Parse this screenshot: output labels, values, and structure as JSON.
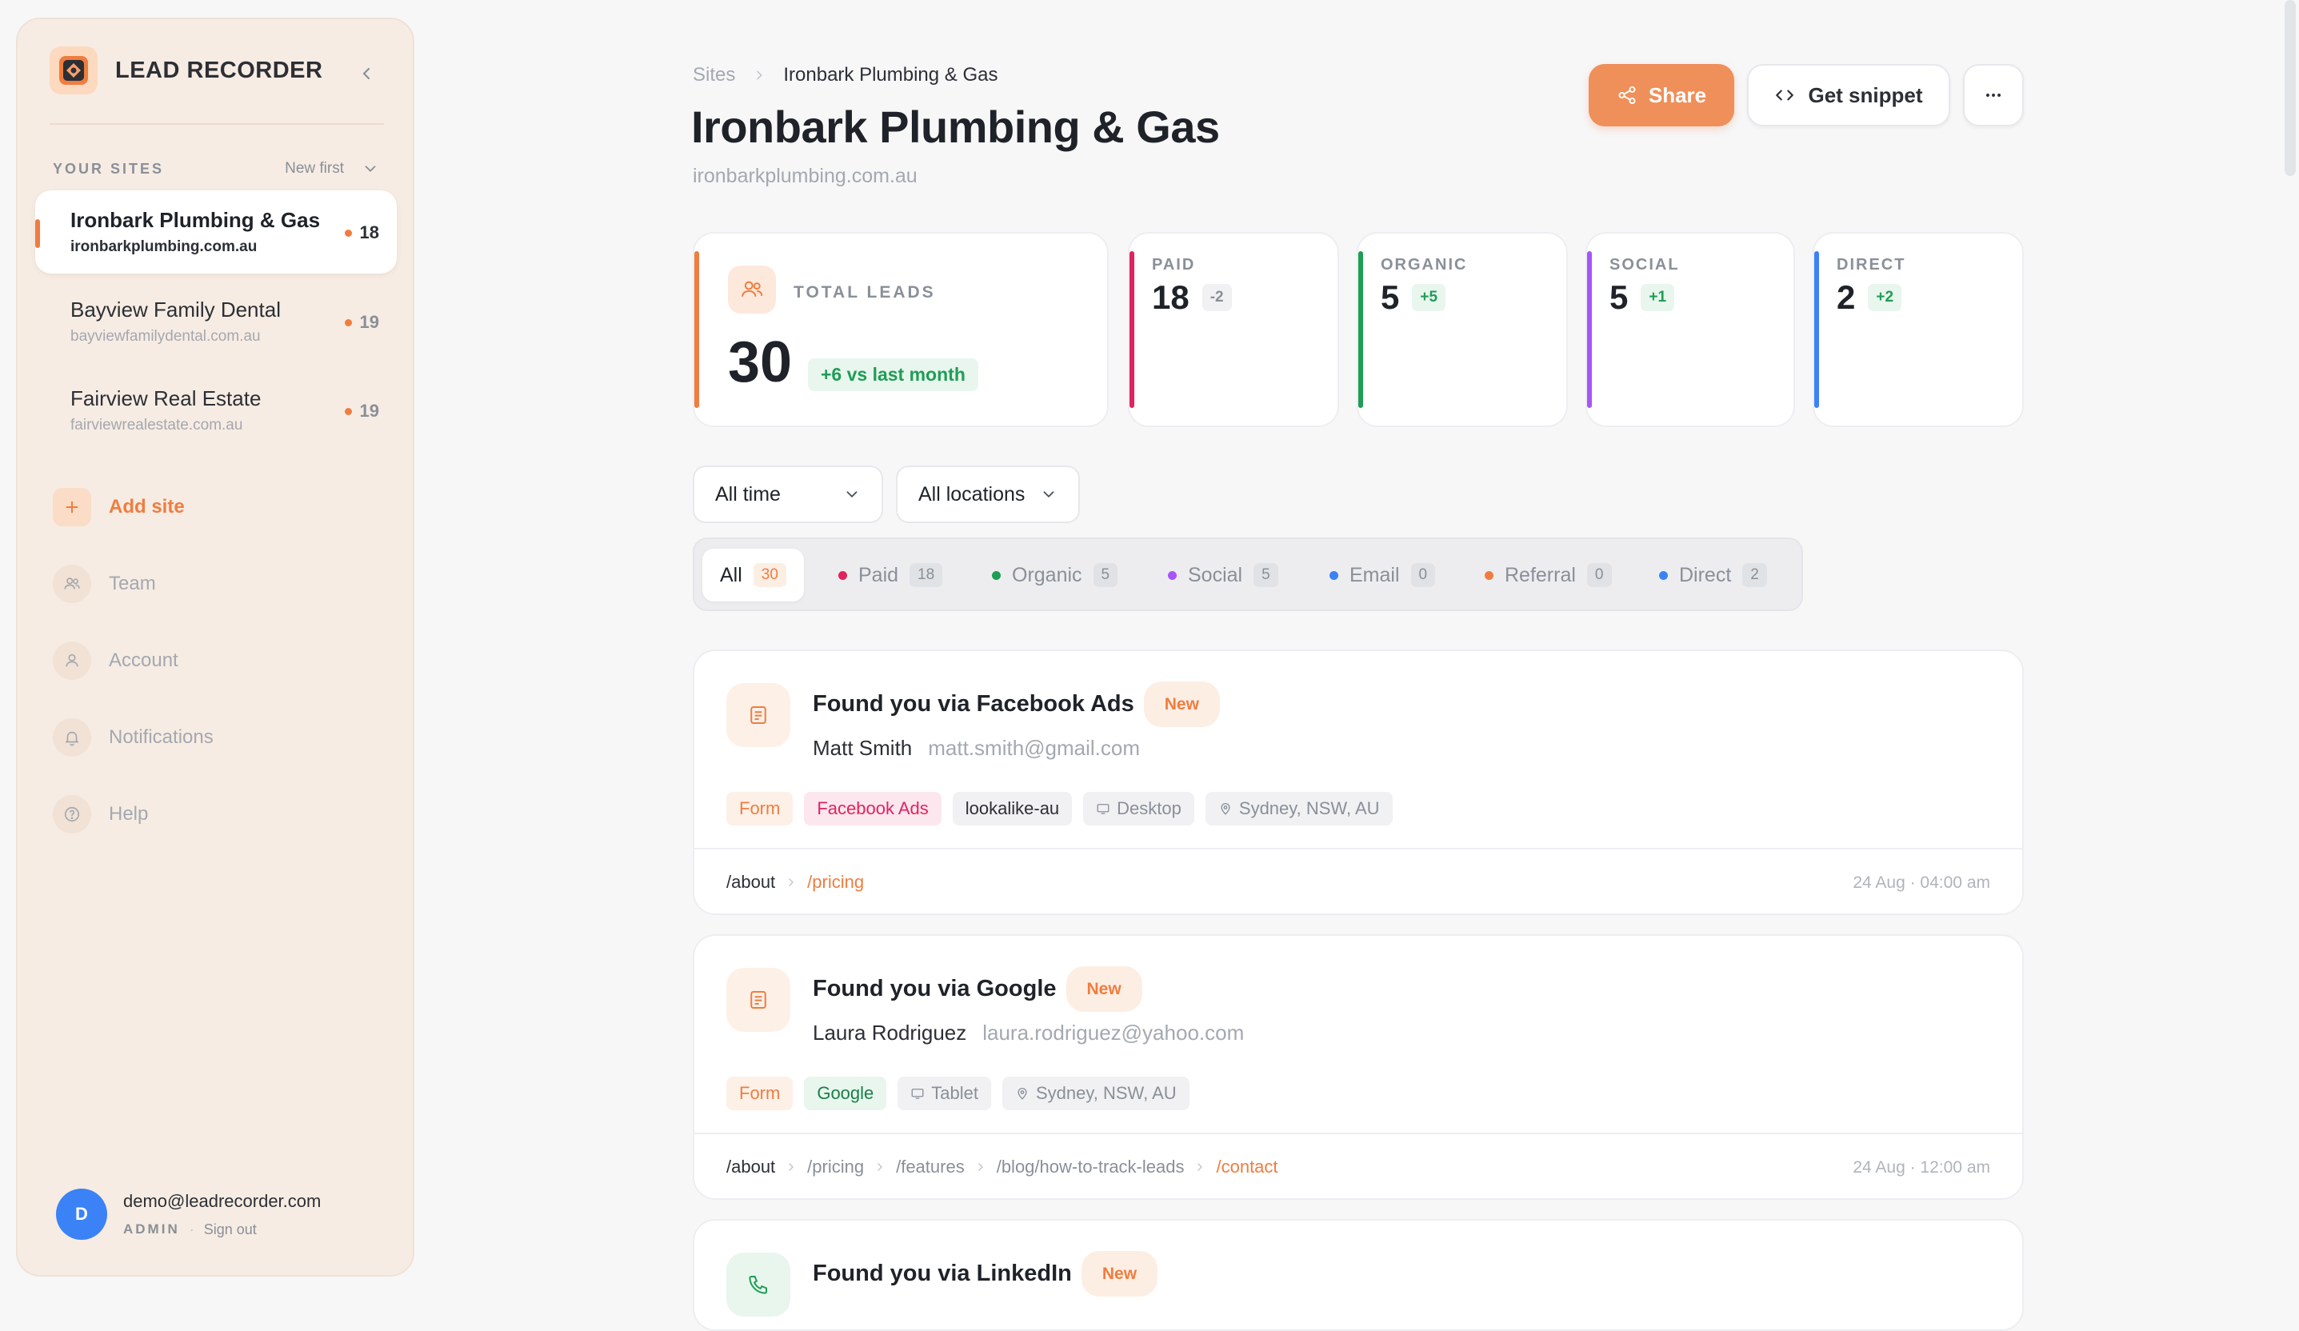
{
  "sidebar": {
    "brand": "LEAD RECORDER",
    "your_sites_label": "YOUR SITES",
    "sort_label": "New first",
    "sites": [
      {
        "name": "Ironbark Plumbing & Gas",
        "domain": "ironbarkplumbing.com.au",
        "count": "18",
        "active": true
      },
      {
        "name": "Bayview Family Dental",
        "domain": "bayviewfamilydental.com.au",
        "count": "19",
        "active": false
      },
      {
        "name": "Fairview Real Estate",
        "domain": "fairviewrealestate.com.au",
        "count": "19",
        "active": false
      }
    ],
    "add_site": "Add site",
    "nav": [
      {
        "label": "Team",
        "icon": "users-icon"
      },
      {
        "label": "Account",
        "icon": "user-icon"
      },
      {
        "label": "Notifications",
        "icon": "bell-icon"
      },
      {
        "label": "Help",
        "icon": "help-icon"
      }
    ],
    "user": {
      "initial": "D",
      "email": "demo@leadrecorder.com",
      "role": "ADMIN",
      "sign_out": "Sign out"
    }
  },
  "header": {
    "breadcrumb_root": "Sites",
    "breadcrumb_current": "Ironbark Plumbing & Gas",
    "title": "Ironbark Plumbing & Gas",
    "domain": "ironbarkplumbing.com.au",
    "share_label": "Share",
    "snippet_label": "Get snippet"
  },
  "stats": {
    "total": {
      "label": "TOTAL LEADS",
      "value": "30",
      "delta": "+6 vs last month",
      "color": "#ef7d3f"
    },
    "categories": [
      {
        "label": "PAID",
        "value": "18",
        "delta": "-2",
        "color": "#e0245e",
        "delta_bg": "#f1f1f3",
        "delta_fg": "#8a8f98"
      },
      {
        "label": "ORGANIC",
        "value": "5",
        "delta": "+5",
        "color": "#1f9d55",
        "delta_bg": "#e8f6ee",
        "delta_fg": "#1f9d55"
      },
      {
        "label": "SOCIAL",
        "value": "5",
        "delta": "+1",
        "color": "#a855f7",
        "delta_bg": "#e8f6ee",
        "delta_fg": "#1f9d55"
      },
      {
        "label": "DIRECT",
        "value": "2",
        "delta": "+2",
        "color": "#3b82f6",
        "delta_bg": "#e8f6ee",
        "delta_fg": "#1f9d55"
      }
    ]
  },
  "filters": {
    "time": "All time",
    "location": "All locations"
  },
  "tabs": [
    {
      "label": "All",
      "count": "30",
      "color": ""
    },
    {
      "label": "Paid",
      "count": "18",
      "color": "#e0245e"
    },
    {
      "label": "Organic",
      "count": "5",
      "color": "#1f9d55"
    },
    {
      "label": "Social",
      "count": "5",
      "color": "#a855f7"
    },
    {
      "label": "Email",
      "count": "0",
      "color": "#3b82f6"
    },
    {
      "label": "Referral",
      "count": "0",
      "color": "#ef7d3f"
    },
    {
      "label": "Direct",
      "count": "2",
      "color": "#3b82f6"
    }
  ],
  "leads": [
    {
      "title": "Found you via Facebook Ads",
      "badge": "New",
      "name": "Matt Smith",
      "email": "matt.smith@gmail.com",
      "type": "Form",
      "source": "Facebook Ads",
      "campaign": "lookalike-au",
      "device": "Desktop",
      "location": "Sydney, NSW, AU",
      "path": [
        "/about",
        "/pricing"
      ],
      "time": "24 Aug · 04:00 am"
    },
    {
      "title": "Found you via Google",
      "badge": "New",
      "name": "Laura Rodriguez",
      "email": "laura.rodriguez@yahoo.com",
      "type": "Form",
      "source": "Google",
      "device": "Tablet",
      "location": "Sydney, NSW, AU",
      "path": [
        "/about",
        "/pricing",
        "/features",
        "/blog/how-to-track-leads",
        "/contact"
      ],
      "time": "24 Aug · 12:00 am"
    },
    {
      "title": "Found you via LinkedIn",
      "badge": "New"
    }
  ]
}
